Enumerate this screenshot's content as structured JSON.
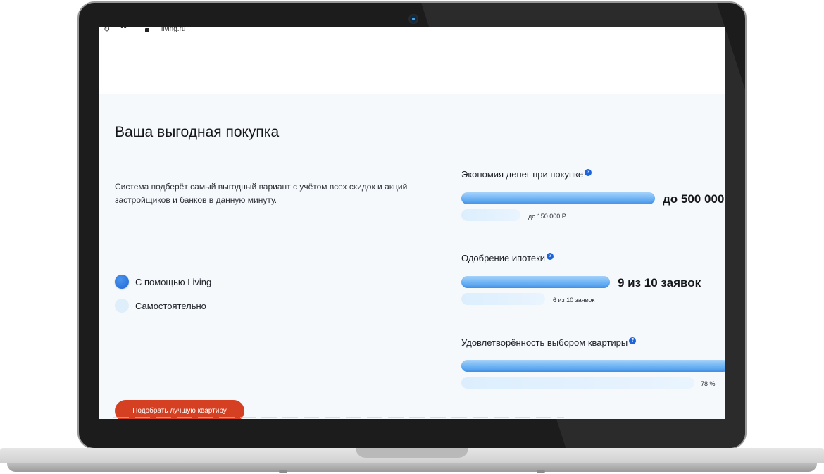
{
  "browser": {
    "url": "living.ru"
  },
  "section": {
    "title": "Ваша выгодная покупка",
    "description": "Система подберёт самый выгодный вариант с учётом всех скидок и акций застройщиков и банков в данную минуту."
  },
  "options": [
    {
      "label": "С помощью Living",
      "selected": true
    },
    {
      "label": "Самостоятельно",
      "selected": false
    }
  ],
  "cta": {
    "label": "Подобрать лучшую квартиру",
    "color": "#d64022"
  },
  "metrics": [
    {
      "title": "Экономия денег при покупке",
      "help": "?",
      "main_label": "до 500 000",
      "sub_label": "до 150 000 Р"
    },
    {
      "title": "Одобрение ипотеки",
      "help": "?",
      "main_label": "9 из 10 заявок",
      "sub_label": "6 из 10 заявок"
    },
    {
      "title": "Удовлетворённость выбором квартиры",
      "help": "?",
      "main_label": "",
      "sub_label": "78 %"
    }
  ],
  "colors": {
    "accent": "#1f66d6",
    "bar": "#6cb2f4",
    "bar_light": "#dceefd",
    "page_bg": "#f5f9fc"
  }
}
